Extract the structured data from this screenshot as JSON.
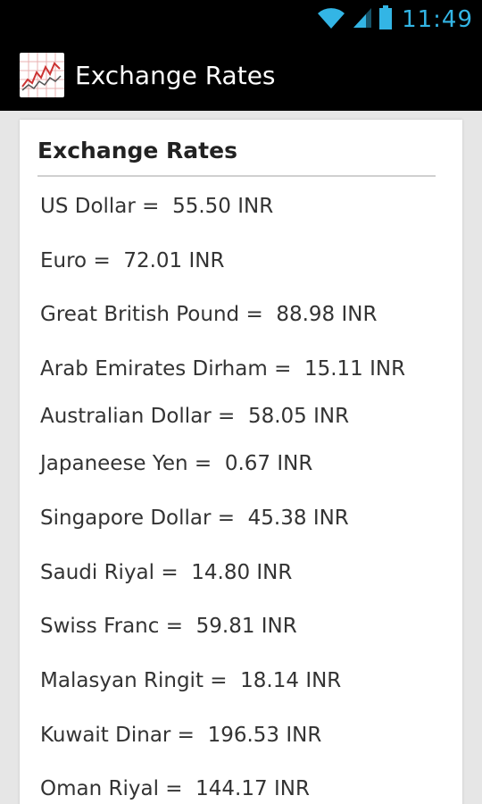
{
  "status_bar": {
    "time": "11:49",
    "icons": [
      "wifi-icon",
      "signal-icon",
      "battery-icon"
    ],
    "accent_color": "#33b5e5"
  },
  "action_bar": {
    "title": "Exchange Rates",
    "icon": "chart-app-icon"
  },
  "card": {
    "title": "Exchange Rates",
    "rates": [
      "US Dollar =  55.50 INR",
      "Euro =  72.01 INR",
      "Great British Pound =  88.98 INR",
      "Arab Emirates Dirham =  15.11 INR",
      "Australian Dollar =  58.05 INR",
      "Japaneese Yen =  0.67 INR",
      "Singapore Dollar =  45.38 INR",
      "Saudi Riyal =  14.80 INR",
      "Swiss Franc =  59.81 INR",
      "Malasyan Ringit =  18.14 INR",
      "Kuwait Dinar =  196.53 INR",
      "Oman Riyal =  144.17 INR"
    ]
  }
}
